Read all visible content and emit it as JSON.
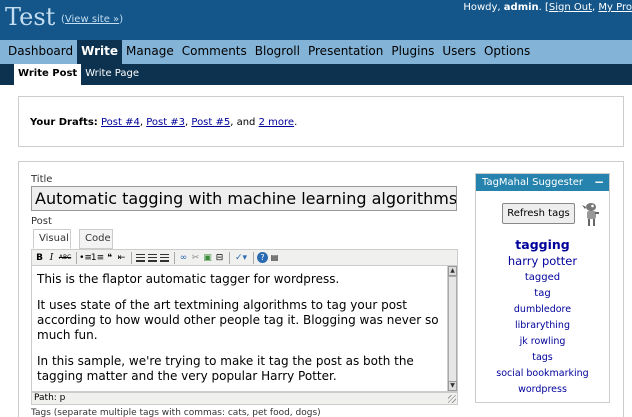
{
  "header": {
    "blog_title": "Test",
    "view_site_open": "(",
    "view_site_label": "View site »",
    "view_site_close": ")",
    "howdy": "Howdy, ",
    "username": "admin",
    "sep": ". [",
    "sign_out": "Sign Out",
    "comma": ", ",
    "my_profile": "My Pro"
  },
  "admin_menu": [
    {
      "label": "Dashboard"
    },
    {
      "label": "Write"
    },
    {
      "label": "Manage"
    },
    {
      "label": "Comments"
    },
    {
      "label": "Blogroll"
    },
    {
      "label": "Presentation"
    },
    {
      "label": "Plugins"
    },
    {
      "label": "Users"
    },
    {
      "label": "Options"
    }
  ],
  "sub_menu": [
    {
      "label": "Write Post"
    },
    {
      "label": "Write Page"
    }
  ],
  "drafts": {
    "label": "Your Drafts:",
    "items": [
      "Post #4",
      "Post #3",
      "Post #5"
    ],
    "and": "and",
    "more": "2 more",
    "end": "."
  },
  "post": {
    "title_label": "Title",
    "title_value": "Automatic tagging with machine learning algorithms",
    "post_label": "Post",
    "tab_visual": "Visual",
    "tab_code": "Code",
    "paragraphs": [
      "This is the flaptor automatic tagger for wordpress.",
      "It uses state of the art textmining algorithms to tag your post according to how would other people tag it. Blogging was never so much fun.",
      "In this sample, we're trying to make it tag the post as both the tagging matter and the very popular Harry Potter."
    ],
    "path": "Path: p",
    "tags_label": "Tags (separate multiple tags with commas: cats, pet food, dogs)"
  },
  "toolbar": {
    "bold": "B",
    "italic": "I",
    "strike": "ABC",
    "help": "?"
  },
  "tag_panel": {
    "title": "TagMahal Suggester",
    "collapse": "−",
    "refresh": "Refresh tags",
    "tags": [
      {
        "label": "tagging",
        "weight": 5
      },
      {
        "label": "harry potter",
        "weight": 4
      },
      {
        "label": "tagged",
        "weight": 3
      },
      {
        "label": "tag",
        "weight": 3
      },
      {
        "label": "dumbledore",
        "weight": 2
      },
      {
        "label": "librarything",
        "weight": 2
      },
      {
        "label": "jk rowling",
        "weight": 2
      },
      {
        "label": "tags",
        "weight": 2
      },
      {
        "label": "social bookmarking",
        "weight": 2
      },
      {
        "label": "wordpress",
        "weight": 2
      }
    ]
  },
  "colors": {
    "header_bg": "#14568a",
    "menu_bg": "#83b4d8",
    "submenu_bg": "#0d324f",
    "link": "#00019b",
    "panel_head": "#2583ad"
  }
}
